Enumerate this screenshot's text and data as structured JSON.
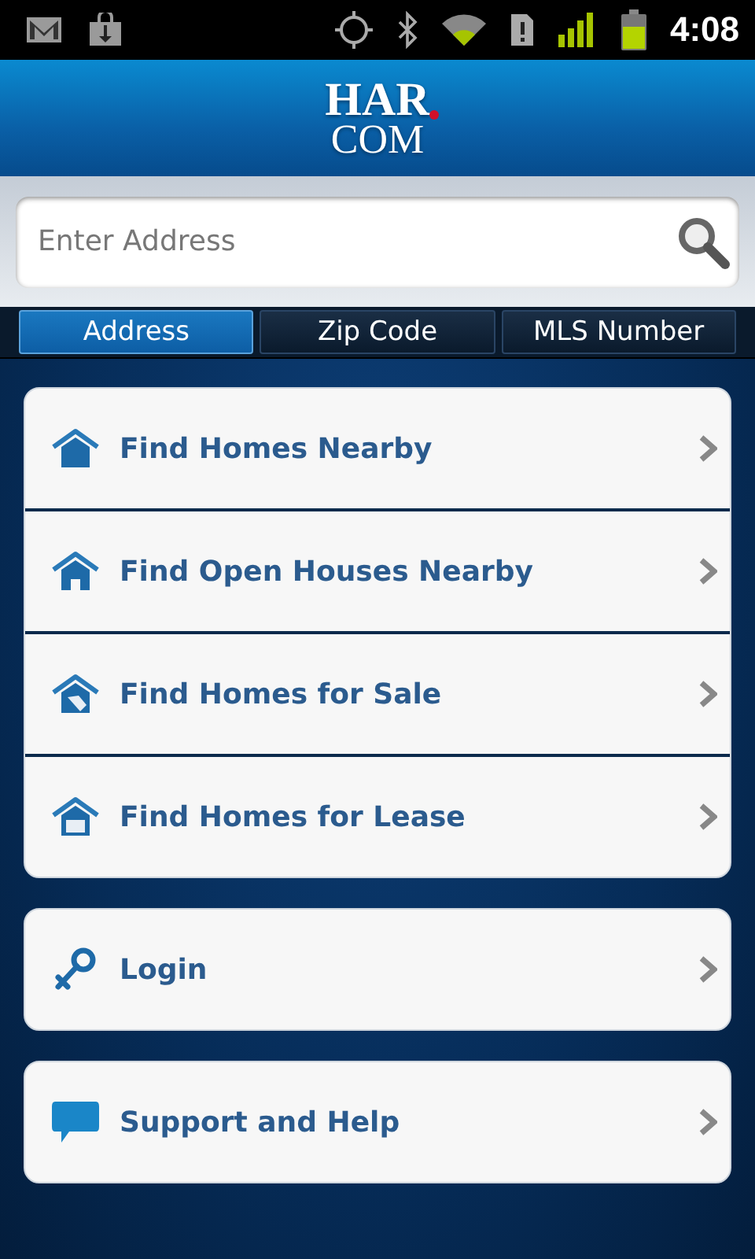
{
  "status_bar": {
    "time": "4:08"
  },
  "header": {
    "logo_top": "HAR",
    "logo_bottom": "COM"
  },
  "search": {
    "placeholder": "Enter Address"
  },
  "tabs": [
    {
      "label": "Address",
      "selected": true
    },
    {
      "label": "Zip Code",
      "selected": false
    },
    {
      "label": "MLS Number",
      "selected": false
    }
  ],
  "menu_groups": [
    {
      "items": [
        {
          "kind": "house",
          "label": "Find Homes Nearby"
        },
        {
          "kind": "house-door",
          "label": "Find Open Houses Nearby"
        },
        {
          "kind": "house-tag",
          "label": "Find Homes for Sale"
        },
        {
          "kind": "house-box",
          "label": "Find Homes for Lease"
        }
      ]
    },
    {
      "items": [
        {
          "kind": "key",
          "label": "Login"
        }
      ]
    },
    {
      "items": [
        {
          "kind": "chat",
          "label": "Support and Help"
        }
      ]
    }
  ]
}
